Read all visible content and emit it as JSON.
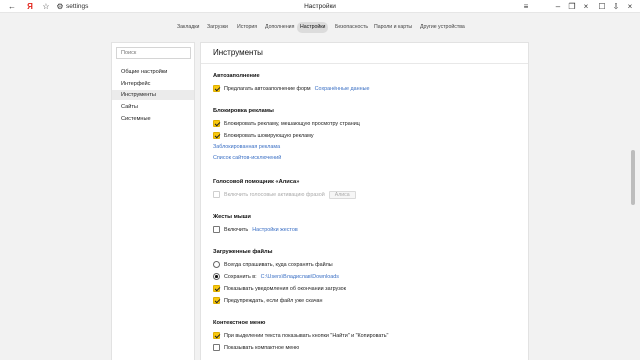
{
  "browser": {
    "url": "settings",
    "window_title": "Настройки",
    "icons": [
      "back-icon",
      "yandex-logo-icon",
      "star-icon",
      "settings-gear-icon"
    ]
  },
  "tabs": [
    {
      "label": "Закладки",
      "active": false
    },
    {
      "label": "Загрузки",
      "active": false
    },
    {
      "label": "История",
      "active": false
    },
    {
      "label": "Дополнения",
      "active": false
    },
    {
      "label": "Настройки",
      "active": true
    },
    {
      "label": "Безопасность",
      "active": false
    },
    {
      "label": "Пароли и карты",
      "active": false
    },
    {
      "label": "Другие устройства",
      "active": false
    }
  ],
  "sidebar": {
    "search_placeholder": "Поиск",
    "items": [
      {
        "label": "Общие настройки",
        "active": false
      },
      {
        "label": "Интерфейс",
        "active": false
      },
      {
        "label": "Инструменты",
        "active": true
      },
      {
        "label": "Сайты",
        "active": false
      },
      {
        "label": "Системные",
        "active": false
      }
    ]
  },
  "content": {
    "title": "Инструменты",
    "autofill": {
      "heading": "Автозаполнение",
      "option": "Предлагать автозаполнение форм",
      "link": "Сохранённые данные"
    },
    "adblock": {
      "heading": "Блокировка рекламы",
      "opt1": "Блокировать рекламу, мешающую просмотру страниц",
      "opt2": "Блокировать шокирующую рекламу",
      "link1": "Заблокированная реклама",
      "link2": "Список сайтов-исключений"
    },
    "voice": {
      "heading": "Голосовой помощник «Алиса»",
      "option": "Включить голосовые активацию фразой",
      "button": "Алиса"
    },
    "gestures": {
      "heading": "Жесты мыши",
      "option": "Включить",
      "link": "Настройки жестов"
    },
    "downloads": {
      "heading": "Загруженные файлы",
      "radio1": "Всегда спрашивать, куда сохранять файлы",
      "radio2": "Сохранить в:",
      "path": "C:\\Users\\Владислав\\Downloads",
      "opt1": "Показывать уведомления об окончании загрузок",
      "opt2": "Предупреждать, если файл уже скачан"
    },
    "context": {
      "heading": "Контекстное меню",
      "opt1": "При выделении текста показывать кнопки \"Найти\" и \"Копировать\"",
      "opt2": "Показывать компактное меню"
    }
  },
  "colors": {
    "accent_checkbox": "#f9c80e",
    "link": "#3a6fc4"
  }
}
